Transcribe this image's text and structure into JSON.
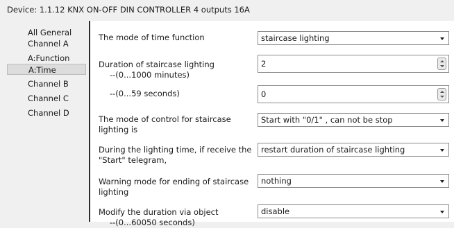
{
  "window": {
    "title": "Device: 1.1.12  KNX ON-OFF DIN CONTROLLER 4 outputs 16A"
  },
  "nav": {
    "items": [
      {
        "label": "All General"
      },
      {
        "label": "Channel A"
      },
      {
        "label": "A:Function"
      },
      {
        "label": "A:Time"
      },
      {
        "label": "Channel B"
      },
      {
        "label": "Channel C"
      },
      {
        "label": "Channel D"
      }
    ],
    "active_index": 3
  },
  "params": {
    "time_mode": {
      "label": "The mode of time function",
      "value": "staircase lighting"
    },
    "duration_min": {
      "label_line1": "Duration of staircase lighting",
      "label_line2": "--(0...1000 minutes)",
      "value": "2"
    },
    "duration_sec": {
      "label": "--(0...59 seconds)",
      "value": "0"
    },
    "control_mode": {
      "label_line1": "The mode of control for staircase",
      "label_line2": "lighting is",
      "value": "Start with \"0/1\" , can not be stop"
    },
    "receive_start": {
      "label_line1": "During the lighting time, if receive the",
      "label_line2": "\"Start\" telegram,",
      "value": "restart duration of staircase lighting"
    },
    "warning_mode": {
      "label_line1": "Warning mode for ending of staircase",
      "label_line2": "lighting",
      "value": "nothing"
    },
    "modify_duration": {
      "label_line1": "Modify the duration via object",
      "label_line2": "--(0...60050 seconds)",
      "value": "disable"
    }
  }
}
